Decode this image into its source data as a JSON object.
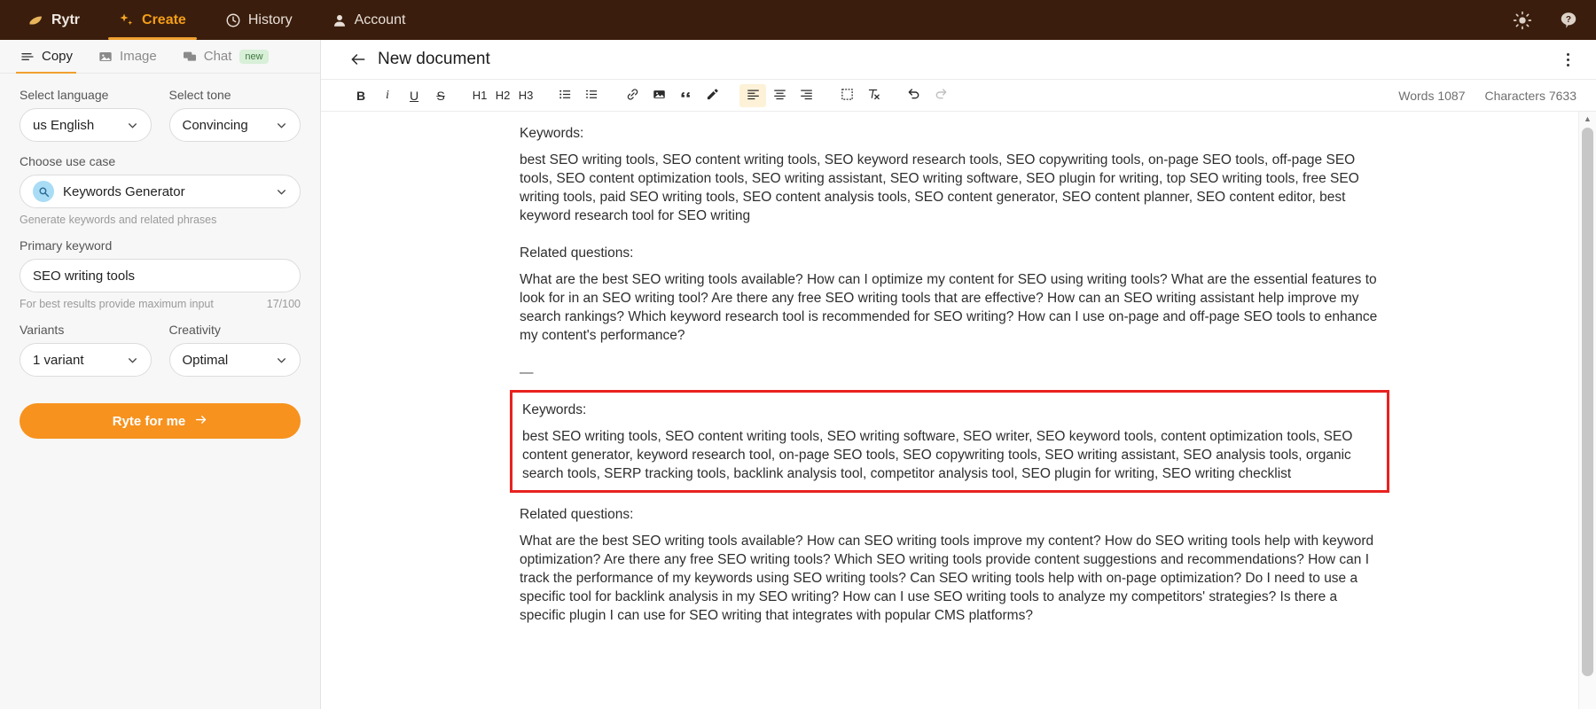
{
  "topbar": {
    "brand": "Rytr",
    "nav": [
      {
        "label": "Rytr",
        "icon": "rytr-logo-icon",
        "active": false
      },
      {
        "label": "Create",
        "icon": "sparkle-icon",
        "active": true
      },
      {
        "label": "History",
        "icon": "clock-icon",
        "active": false
      },
      {
        "label": "Account",
        "icon": "person-icon",
        "active": false
      }
    ],
    "right": [
      {
        "name": "theme-toggle",
        "icon": "sun-icon"
      },
      {
        "name": "help",
        "icon": "help-icon"
      }
    ],
    "bg_color": "#3a1d0c",
    "accent_color": "#f59e18"
  },
  "sidebar": {
    "tabs": [
      {
        "label": "Copy",
        "icon": "lines-icon",
        "active": true,
        "badge": ""
      },
      {
        "label": "Image",
        "icon": "image-icon",
        "active": false,
        "badge": ""
      },
      {
        "label": "Chat",
        "icon": "chat-icon",
        "active": false,
        "badge": "new"
      }
    ],
    "language": {
      "label": "Select language",
      "value": "us English"
    },
    "tone": {
      "label": "Select tone",
      "value": "Convincing"
    },
    "use_case": {
      "label": "Choose use case",
      "value": "Keywords Generator",
      "icon": "magnifier-icon",
      "description": "Generate keywords and related phrases"
    },
    "primary_keyword": {
      "label": "Primary keyword",
      "value": "SEO writing tools",
      "hint": "For best results provide maximum input",
      "counter": "17/100"
    },
    "variants": {
      "label": "Variants",
      "value": "1 variant"
    },
    "creativity": {
      "label": "Creativity",
      "value": "Optimal"
    },
    "cta": {
      "label": "Ryte for me",
      "icon": "arrow-right-icon",
      "color": "#f7921e"
    }
  },
  "document": {
    "title": "New document",
    "back_icon": "arrow-left-icon",
    "menu_icon": "kebab-menu-icon",
    "toolbar": [
      {
        "name": "bold",
        "label": "B",
        "style": "bold"
      },
      {
        "name": "italic",
        "label": "i",
        "style": "ital"
      },
      {
        "name": "underline",
        "label": "U",
        "style": "und"
      },
      {
        "name": "strikethrough",
        "label": "S",
        "style": "strike"
      },
      {
        "name": "heading-1",
        "label": "H1",
        "style": "head"
      },
      {
        "name": "heading-2",
        "label": "H2",
        "style": "head"
      },
      {
        "name": "heading-3",
        "label": "H3",
        "style": "head"
      },
      {
        "name": "bullet-list",
        "label": "",
        "style": "icon"
      },
      {
        "name": "numbered-list",
        "label": "",
        "style": "icon"
      },
      {
        "name": "link",
        "label": "",
        "style": "icon"
      },
      {
        "name": "image",
        "label": "",
        "style": "icon"
      },
      {
        "name": "blockquote",
        "label": "",
        "style": "icon"
      },
      {
        "name": "highlighter",
        "label": "",
        "style": "icon"
      },
      {
        "name": "align-left",
        "label": "",
        "style": "icon"
      },
      {
        "name": "align-center",
        "label": "",
        "style": "icon"
      },
      {
        "name": "align-right",
        "label": "",
        "style": "icon"
      },
      {
        "name": "insert-block",
        "label": "",
        "style": "icon"
      },
      {
        "name": "clear-format",
        "label": "",
        "style": "icon"
      },
      {
        "name": "undo",
        "label": "",
        "style": "icon"
      },
      {
        "name": "redo",
        "label": "",
        "style": "icon"
      }
    ],
    "words_label": "Words 1087",
    "characters_label": "Characters 7633",
    "body": {
      "block1_heading": "Keywords:",
      "block1_text": "best SEO writing tools, SEO content writing tools, SEO keyword research tools, SEO copywriting tools, on-page SEO tools, off-page SEO tools, SEO content optimization tools, SEO writing assistant, SEO writing software, SEO plugin for writing, top SEO writing tools, free SEO writing tools, paid SEO writing tools, SEO content analysis tools, SEO content generator, SEO content planner, SEO content editor, best keyword research tool for SEO writing",
      "block2_heading": "Related questions:",
      "block2_text": "What are the best SEO writing tools available? How can I optimize my content for SEO using writing tools? What are the essential features to look for in an SEO writing tool? Are there any free SEO writing tools that are effective? How can an SEO writing assistant help improve my search rankings? Which keyword research tool is recommended for SEO writing? How can I use on-page and off-page SEO tools to enhance my content's performance?",
      "divider": "—",
      "highlighted_heading": "Keywords:",
      "highlighted_text": "best SEO writing tools, SEO content writing tools, SEO writing software, SEO writer, SEO keyword tools, content optimization tools, SEO content generator, keyword research tool, on-page SEO tools, SEO copywriting tools, SEO writing assistant, SEO analysis tools, organic search tools, SERP tracking tools, backlink analysis tool, competitor analysis tool, SEO plugin for writing, SEO writing checklist",
      "block4_heading": "Related questions:",
      "block4_text": "What are the best SEO writing tools available? How can SEO writing tools improve my content? How do SEO writing tools help with keyword optimization? Are there any free SEO writing tools? Which SEO writing tools provide content suggestions and recommendations? How can I track the performance of my keywords using SEO writing tools? Can SEO writing tools help with on-page optimization? Do I need to use a specific tool for backlink analysis in my SEO writing? How can I use SEO writing tools to analyze my competitors' strategies? Is there a specific plugin I can use for SEO writing that integrates with popular CMS platforms?",
      "highlight_color": "#e8221f"
    }
  }
}
